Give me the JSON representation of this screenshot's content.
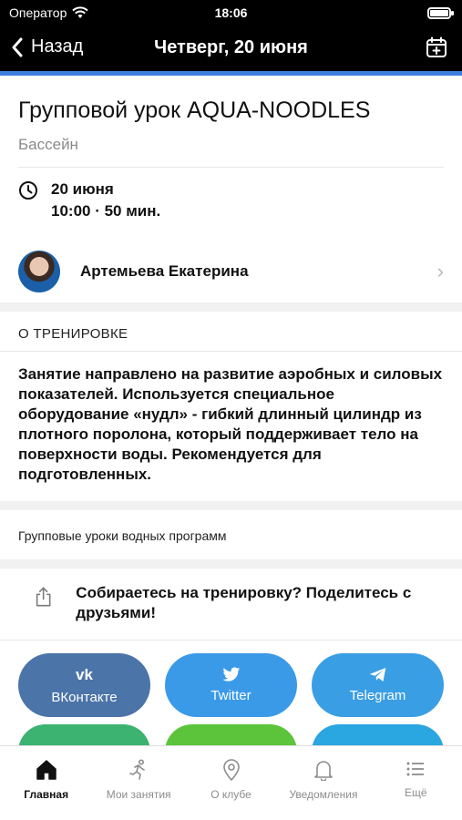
{
  "status": {
    "carrier": "Оператор",
    "time": "18:06"
  },
  "navbar": {
    "back_label": "Назад",
    "title": "Четверг, 20 июня"
  },
  "lesson": {
    "title": "Групповой урок AQUA-NOODLES",
    "location": "Бассейн",
    "date": "20 июня",
    "time_duration": "10:00 · 50 мин."
  },
  "trainer": {
    "name": "Артемьева Екатерина"
  },
  "about": {
    "header": "О ТРЕНИРОВКЕ",
    "text": "Занятие направлено на развитие аэробных и силовых показателей. Используется специальное оборудование «нудл» - гибкий длинный цилиндр из плотного поролона, который поддерживает тело на поверхности воды. Рекомендуется для подготовленных."
  },
  "category": "Групповые уроки водных программ",
  "share": {
    "text": "Собираетесь на тренировку? Поделитесь с друзьями!",
    "buttons": [
      {
        "label": "ВКонтакте",
        "icon": "vk",
        "color": "#4b74a8"
      },
      {
        "label": "Twitter",
        "icon": "twitter-bird",
        "color": "#3b9ae8"
      },
      {
        "label": "Telegram",
        "icon": "telegram-plane",
        "color": "#3a9ee4"
      }
    ]
  },
  "tabbar": {
    "items": [
      {
        "label": "Главная",
        "icon": "home-icon",
        "active": true
      },
      {
        "label": "Мои занятия",
        "icon": "runner-icon",
        "active": false
      },
      {
        "label": "О клубе",
        "icon": "location-pin-icon",
        "active": false
      },
      {
        "label": "Уведомления",
        "icon": "bell-icon",
        "active": false
      },
      {
        "label": "Ещё",
        "icon": "list-icon",
        "active": false
      }
    ]
  },
  "colors": {
    "accent": "#3f7fe0",
    "nav_background": "#000000"
  }
}
